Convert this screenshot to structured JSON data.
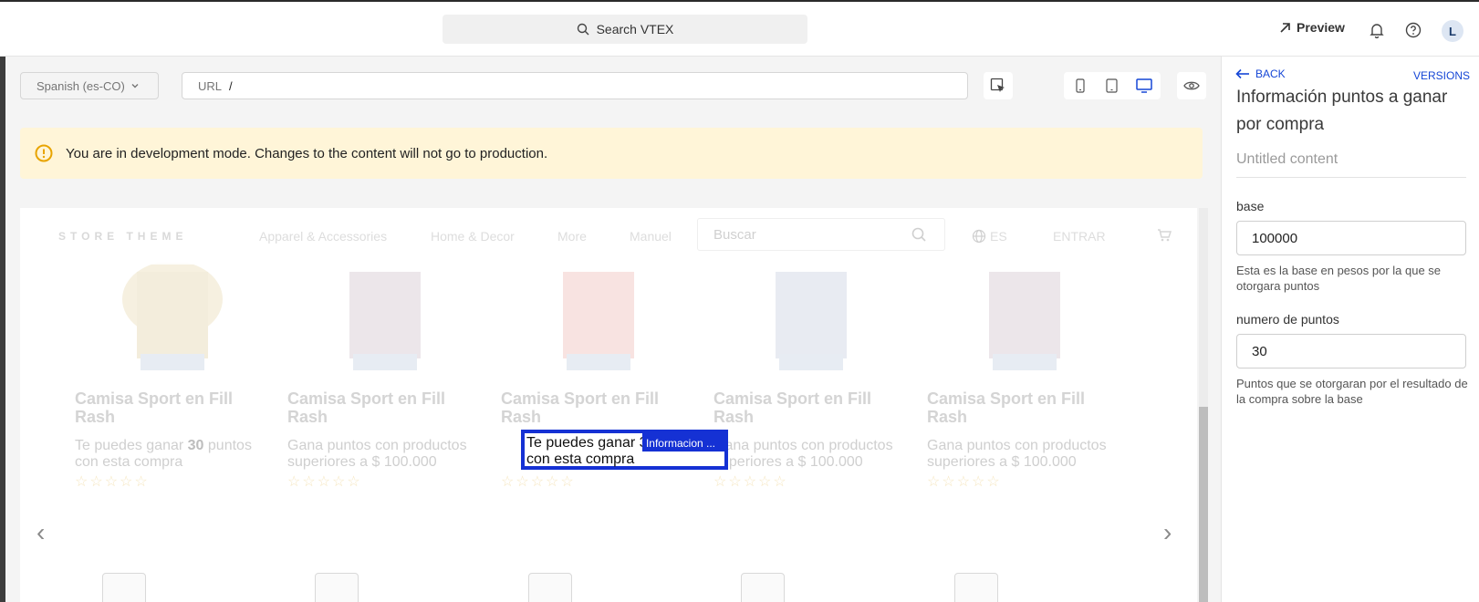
{
  "topbar": {
    "search_label": "Search VTEX",
    "preview_label": "Preview",
    "avatar_initial": "L"
  },
  "toolbar": {
    "locale": "Spanish (es-CO)",
    "url_label": "URL",
    "url_value": "/"
  },
  "warning": {
    "text": "You are in development mode. Changes to the content will not go to production."
  },
  "store": {
    "logo": "STORE THEME",
    "nav": [
      "Apparel & Accessories",
      "Home & Decor",
      "More",
      "Manuel"
    ],
    "search_placeholder": "Buscar",
    "language": "ES",
    "login": "ENTRAR"
  },
  "products": [
    {
      "name": "Camisa Sport en Fill Rash",
      "desc_prefix": "Te puedes ganar ",
      "desc_points": "30",
      "desc_suffix": " puntos con esta compra",
      "shirt_color": "#efe3c5"
    },
    {
      "name": "Camisa Sport en Fill Rash",
      "desc": "Gana puntos con productos superiores a $ 100.000",
      "shirt_color": "#3a2a3a"
    },
    {
      "name": "Camisa Sport en Fill Rash",
      "desc": "Te puedes ganar 30 puntos con esta compra",
      "shirt_color": "#e26a5e"
    },
    {
      "name": "Camisa Sport en Fill Rash",
      "desc": "Gana puntos con productos superiores a $ 100.000",
      "shirt_color": "#6f7fa6"
    },
    {
      "name": "Camisa Sport en Fill Rash",
      "desc": "Gana puntos con productos superiores a $ 100.000",
      "shirt_color": "#3a2a3a"
    }
  ],
  "selection": {
    "text": "Te puedes ganar 30 puntos con esta compra",
    "tag": "Informacion ..."
  },
  "sidebar": {
    "back_label": "BACK",
    "versions_label": "VERSIONS",
    "title": "Información puntos a ganar por compra",
    "content_name_placeholder": "Untitled content",
    "fields": [
      {
        "label": "base",
        "value": "100000",
        "help": "Esta es la base en pesos por la que se otorgara puntos"
      },
      {
        "label": "numero de puntos",
        "value": "30",
        "help": "Puntos que se otorgaran por el resultado de la compra sobre la base"
      }
    ]
  },
  "colors": {
    "accent": "#1546d6",
    "selection": "#1531d4",
    "warning_bg": "#fff5d8",
    "warning_icon": "#e8a400"
  }
}
